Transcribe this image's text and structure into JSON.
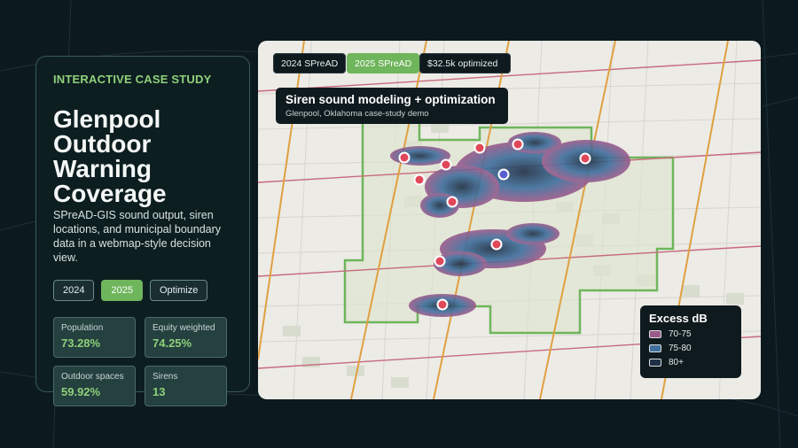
{
  "case_study": {
    "eyebrow": "INTERACTIVE CASE STUDY",
    "title_lines": [
      "Glenpool",
      "Outdoor",
      "Warning",
      "Coverage"
    ],
    "description": "SPreAD-GIS sound output, siren locations, and municipal boundary data in a webmap-style decision view.",
    "toggles": [
      {
        "label": "2024",
        "active": false
      },
      {
        "label": "2025",
        "active": true
      },
      {
        "label": "Optimize",
        "active": false
      }
    ],
    "stats": [
      {
        "label": "Population",
        "value": "73.28%"
      },
      {
        "label": "Equity weighted",
        "value": "74.25%"
      },
      {
        "label": "Outdoor spaces",
        "value": "59.92%"
      },
      {
        "label": "Sirens",
        "value": "13"
      }
    ]
  },
  "map": {
    "chips": [
      {
        "label": "2024 SPreAD",
        "active": false
      },
      {
        "label": "2025 SPreAD",
        "active": true
      },
      {
        "label": "$32.5k optimized",
        "active": false
      }
    ],
    "info_title": "Siren sound modeling + optimization",
    "info_subtitle": "Glenpool, Oklahoma case-study demo",
    "legend": {
      "title": "Excess dB",
      "items": [
        {
          "label": "70-75",
          "color": "#9b5a8c"
        },
        {
          "label": "75-80",
          "color": "#3f6f9e"
        },
        {
          "label": "80+",
          "color": "#1f2f45"
        }
      ]
    },
    "colors": {
      "boundary": "#6fb55c",
      "siren": "#e0485a",
      "selected_siren": "#5a5fd0",
      "highway": "#e0a040",
      "arterial": "#c86a7c"
    }
  }
}
